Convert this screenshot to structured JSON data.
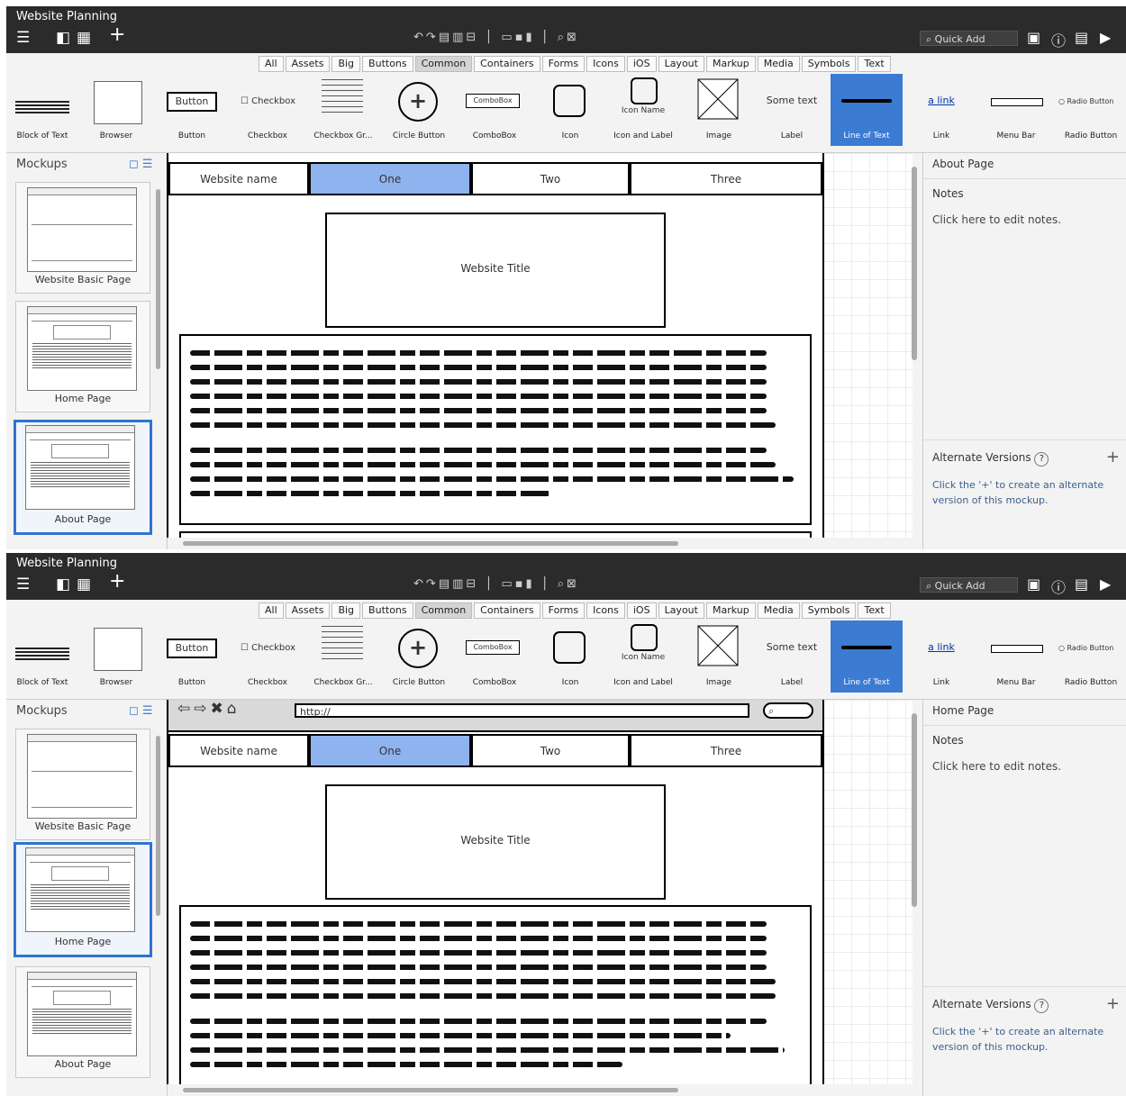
{
  "app": {
    "title": "Website Planning",
    "quick_add_placeholder": "Quick Add",
    "toolbar_icons": [
      "menu-icon",
      "single-view-icon",
      "grid-view-icon",
      "add-icon",
      "undo-icon",
      "redo-icon",
      "group-icon",
      "ungroup-icon",
      "lock-icon",
      "delete-icon",
      "search-icon",
      "markup-icon",
      "account-icon",
      "info-icon",
      "list-icon",
      "present-icon"
    ]
  },
  "filters": [
    "All",
    "Assets",
    "Big",
    "Buttons",
    "Common",
    "Containers",
    "Forms",
    "Icons",
    "iOS",
    "Layout",
    "Markup",
    "Media",
    "Symbols",
    "Text"
  ],
  "selected_filter": "Common",
  "library": [
    {
      "label": "Block of Text"
    },
    {
      "label": "Browser"
    },
    {
      "label": "Button",
      "preview": "Button"
    },
    {
      "label": "Checkbox",
      "preview": "Checkbox"
    },
    {
      "label": "Checkbox Gr..."
    },
    {
      "label": "Circle Button",
      "preview": "+"
    },
    {
      "label": "ComboBox",
      "preview": "ComboBox"
    },
    {
      "label": "Icon"
    },
    {
      "label": "Icon and Label",
      "preview": "Icon Name"
    },
    {
      "label": "Image"
    },
    {
      "label": "Label",
      "preview": "Some text"
    },
    {
      "label": "Line of Text"
    },
    {
      "label": "Link",
      "preview": "a link"
    },
    {
      "label": "Menu Bar"
    },
    {
      "label": "Radio Button",
      "preview": "Radio Button"
    }
  ],
  "sidebar": {
    "header": "Mockups",
    "mockups": [
      "Website Basic Page",
      "Home Page",
      "About Page"
    ]
  },
  "mockup": {
    "nav": [
      "Website name",
      "One",
      "Two",
      "Three"
    ],
    "title": "Website Title",
    "url": "http://"
  },
  "props": {
    "notes_label": "Notes",
    "notes_placeholder": "Click here to edit notes.",
    "alt_label": "Alternate Versions",
    "alt_help": "?",
    "alt_note": "Click the '+' to create an alternate version of this mockup."
  },
  "screens": [
    {
      "selected_mockup": "About Page",
      "page_title": "About Page"
    },
    {
      "selected_mockup": "Home Page",
      "page_title": "Home Page"
    }
  ]
}
